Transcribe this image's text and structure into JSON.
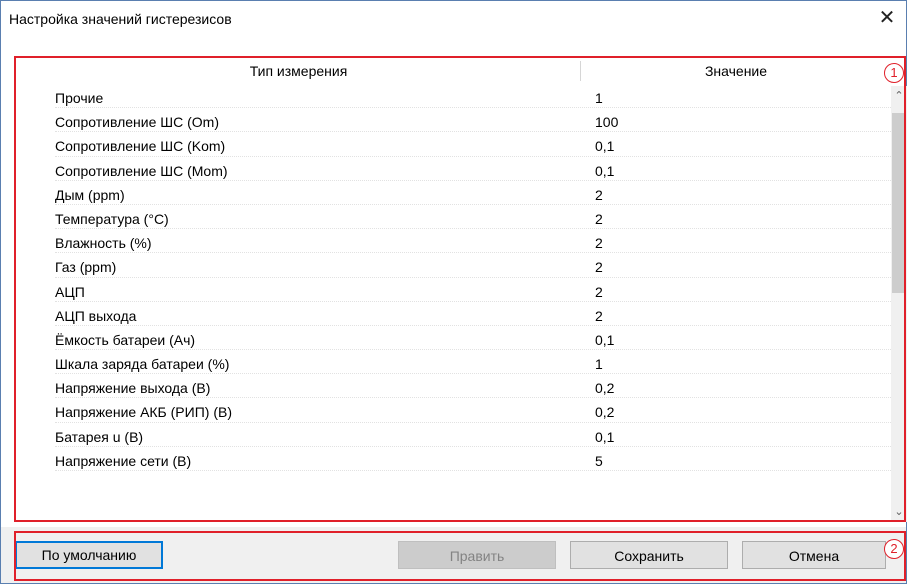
{
  "window": {
    "title": "Настройка значений гистерезисов"
  },
  "table": {
    "col_type": "Тип измерения",
    "col_value": "Значение",
    "rows": [
      {
        "name": "Прочие",
        "value": "1"
      },
      {
        "name": "Сопротивление ШС (Om)",
        "value": "100"
      },
      {
        "name": "Сопротивление ШС (Kom)",
        "value": "0,1"
      },
      {
        "name": "Сопротивление ШС (Mom)",
        "value": "0,1"
      },
      {
        "name": "Дым (ppm)",
        "value": "2"
      },
      {
        "name": "Температура (°C)",
        "value": "2"
      },
      {
        "name": "Влажность (%)",
        "value": "2"
      },
      {
        "name": "Газ (ppm)",
        "value": "2"
      },
      {
        "name": "АЦП",
        "value": "2"
      },
      {
        "name": "АЦП выхода",
        "value": "2"
      },
      {
        "name": "Ёмкость батареи (Ач)",
        "value": "0,1"
      },
      {
        "name": "Шкала заряда батареи (%)",
        "value": "1"
      },
      {
        "name": "Напряжение выхода (В)",
        "value": "0,2"
      },
      {
        "name": "Напряжение АКБ (РИП) (В)",
        "value": "0,2"
      },
      {
        "name": "Батарея u (В)",
        "value": "0,1"
      },
      {
        "name": "Напряжение сети (В)",
        "value": "5"
      }
    ]
  },
  "annotations": {
    "badge1": "1",
    "badge2": "2",
    "color": "#e0202a"
  },
  "buttons": {
    "default": "По умолчанию",
    "edit": "Править",
    "save": "Сохранить",
    "cancel": "Отмена"
  }
}
